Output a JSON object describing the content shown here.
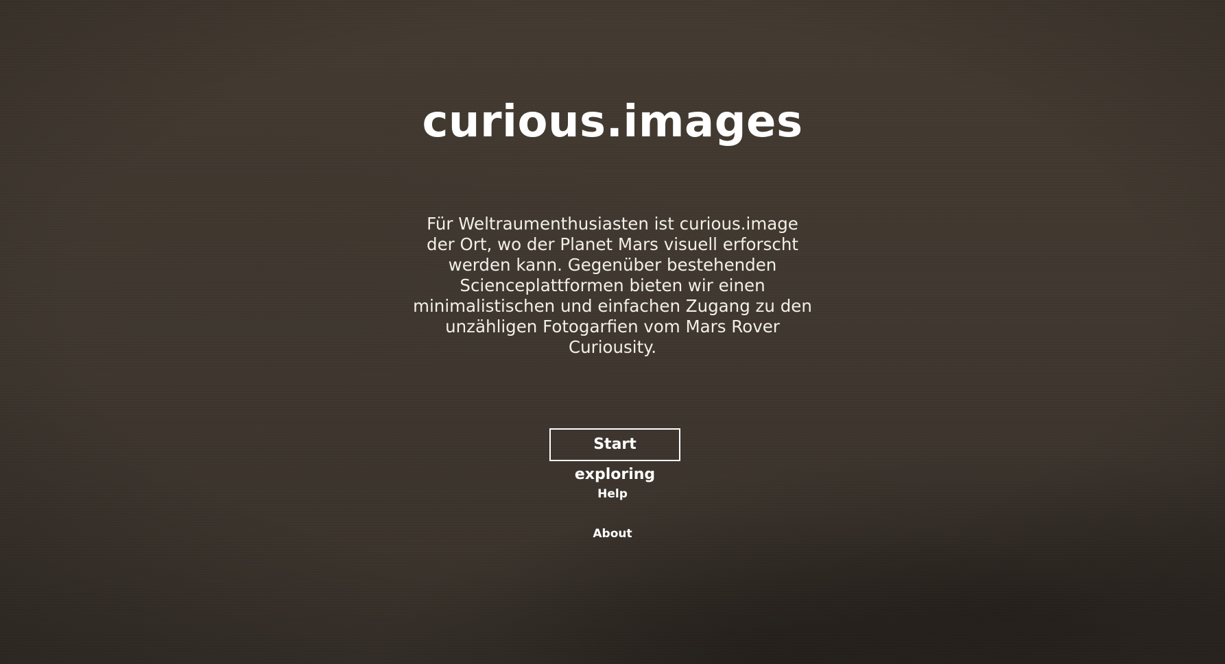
{
  "hero": {
    "title": "curious.images",
    "description": "Für Weltraumenthusiasten ist curious.image der Ort, wo der Planet Mars visuell erforscht werden kann. Gegenüber bestehenden Scienceplattformen bieten wir einen minimalistischen und einfachen Zugang zu den unzähligen Fotogarfien vom Mars Rover Curiousity.",
    "cta_label": "Start exploring"
  },
  "nav": {
    "help_label": "Help",
    "about_label": "About"
  },
  "colors": {
    "background": "#413830",
    "text": "#ffffff",
    "button_border": "#ffffff"
  }
}
